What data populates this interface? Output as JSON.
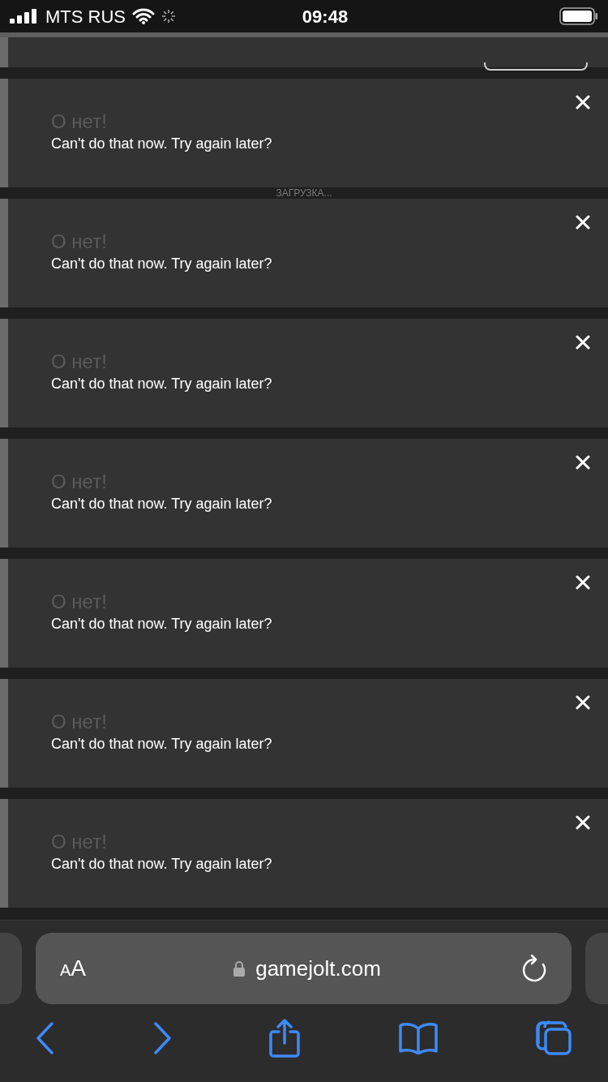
{
  "status_bar": {
    "carrier": "MTS RUS",
    "time": "09:48"
  },
  "loading_text": "ЗАГРУЗКА...",
  "toasts": [
    {
      "title": "О нет!",
      "message": "Can't do that now. Try again later?"
    },
    {
      "title": "О нет!",
      "message": "Can't do that now. Try again later?"
    },
    {
      "title": "О нет!",
      "message": "Can't do that now. Try again later?"
    },
    {
      "title": "О нет!",
      "message": "Can't do that now. Try again later?"
    },
    {
      "title": "О нет!",
      "message": "Can't do that now. Try again later?"
    },
    {
      "title": "О нет!",
      "message": "Can't do that now. Try again later?"
    },
    {
      "title": "О нет!",
      "message": "Can't do that now. Try again later?"
    }
  ],
  "browser": {
    "text_size_button": "AA",
    "url": "gamejolt.com"
  }
}
